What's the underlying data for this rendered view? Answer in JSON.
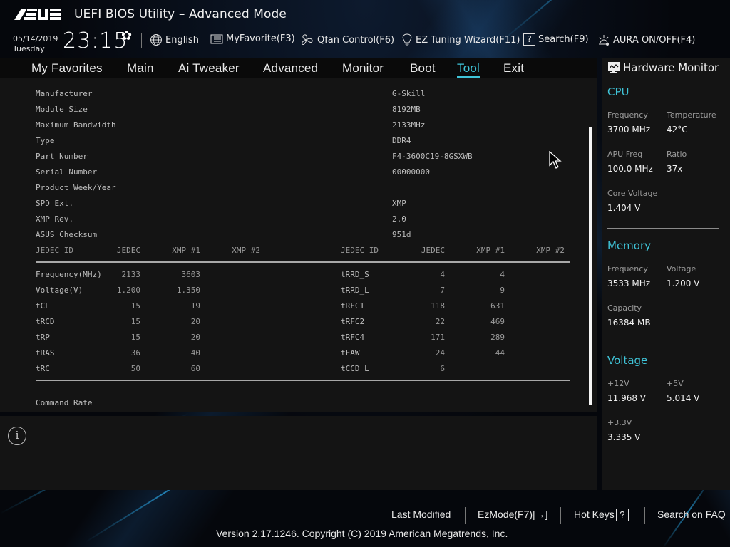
{
  "header": {
    "brand": "ASUS",
    "title": "UEFI BIOS Utility – Advanced Mode",
    "date": "05/14/2019",
    "day": "Tuesday",
    "time": "23:15",
    "tools": [
      {
        "icon": "globe-icon",
        "label": "English"
      },
      {
        "icon": "favorite-list-icon",
        "label": "MyFavorite(F3)"
      },
      {
        "icon": "fan-icon",
        "label": "Qfan Control(F6)"
      },
      {
        "icon": "lightbulb-icon",
        "label": "EZ Tuning Wizard(F11)"
      },
      {
        "icon": "question-box-icon",
        "label": "Search(F9)"
      },
      {
        "icon": "aura-light-icon",
        "label": "AURA ON/OFF(F4)"
      }
    ]
  },
  "nav": {
    "tabs": [
      "My Favorites",
      "Main",
      "Ai Tweaker",
      "Advanced",
      "Monitor",
      "Boot",
      "Tool",
      "Exit"
    ],
    "active": "Tool"
  },
  "spd_info": [
    {
      "label": "Manufacturer",
      "value": "G-Skill"
    },
    {
      "label": "Module Size",
      "value": "8192MB"
    },
    {
      "label": "Maximum Bandwidth",
      "value": "2133MHz"
    },
    {
      "label": "Type",
      "value": "DDR4"
    },
    {
      "label": "Part Number",
      "value": "F4-3600C19-8GSXWB"
    },
    {
      "label": "Serial Number",
      "value": "00000000"
    },
    {
      "label": "Product Week/Year",
      "value": ""
    },
    {
      "label": "SPD Ext.",
      "value": "XMP"
    },
    {
      "label": "XMP Rev.",
      "value": "2.0"
    },
    {
      "label": "ASUS Checksum",
      "value": "951d"
    }
  ],
  "timing_table": {
    "headers": [
      "JEDEC ID",
      "JEDEC",
      "XMP #1",
      "XMP #2"
    ],
    "left_rows": [
      [
        "Frequency(MHz)",
        "2133",
        "3603",
        ""
      ],
      [
        "Voltage(V)",
        "1.200",
        "1.350",
        ""
      ],
      [
        "tCL",
        "15",
        "19",
        ""
      ],
      [
        "tRCD",
        "15",
        "20",
        ""
      ],
      [
        "tRP",
        "15",
        "20",
        ""
      ],
      [
        "tRAS",
        "36",
        "40",
        ""
      ],
      [
        "tRC",
        "50",
        "60",
        ""
      ]
    ],
    "right_rows": [
      [
        "tRRD_S",
        "4",
        "4",
        ""
      ],
      [
        "tRRD_L",
        "7",
        "9",
        ""
      ],
      [
        "tRFC1",
        "118",
        "631",
        ""
      ],
      [
        "tRFC2",
        "22",
        "469",
        ""
      ],
      [
        "tRFC4",
        "171",
        "289",
        ""
      ],
      [
        "tFAW",
        "24",
        "44",
        ""
      ],
      [
        "tCCD_L",
        "6",
        "",
        ""
      ]
    ]
  },
  "command_rate_label": "Command Rate",
  "hardware_monitor": {
    "title": "Hardware Monitor",
    "cpu": {
      "title": "CPU",
      "frequency_label": "Frequency",
      "frequency": "3700 MHz",
      "temperature_label": "Temperature",
      "temperature": "42°C",
      "apu_label": "APU Freq",
      "apu": "100.0 MHz",
      "ratio_label": "Ratio",
      "ratio": "37x",
      "core_voltage_label": "Core Voltage",
      "core_voltage": "1.404 V"
    },
    "memory": {
      "title": "Memory",
      "frequency_label": "Frequency",
      "frequency": "3533 MHz",
      "voltage_label": "Voltage",
      "voltage": "1.200 V",
      "capacity_label": "Capacity",
      "capacity": "16384 MB"
    },
    "voltage": {
      "title": "Voltage",
      "v12_label": "+12V",
      "v12": "11.968 V",
      "v5_label": "+5V",
      "v5": "5.014 V",
      "v33_label": "+3.3V",
      "v33": "3.335 V"
    }
  },
  "footer": {
    "last_modified": "Last Modified",
    "ezmode": "EzMode(F7)|",
    "hotkeys": "Hot Keys",
    "hotkeys_glyph": "?",
    "faq": "Search on FAQ",
    "version": "Version 2.17.1246. Copyright (C) 2019 American Megatrends, Inc."
  },
  "accent_color": "#3fc4d8"
}
